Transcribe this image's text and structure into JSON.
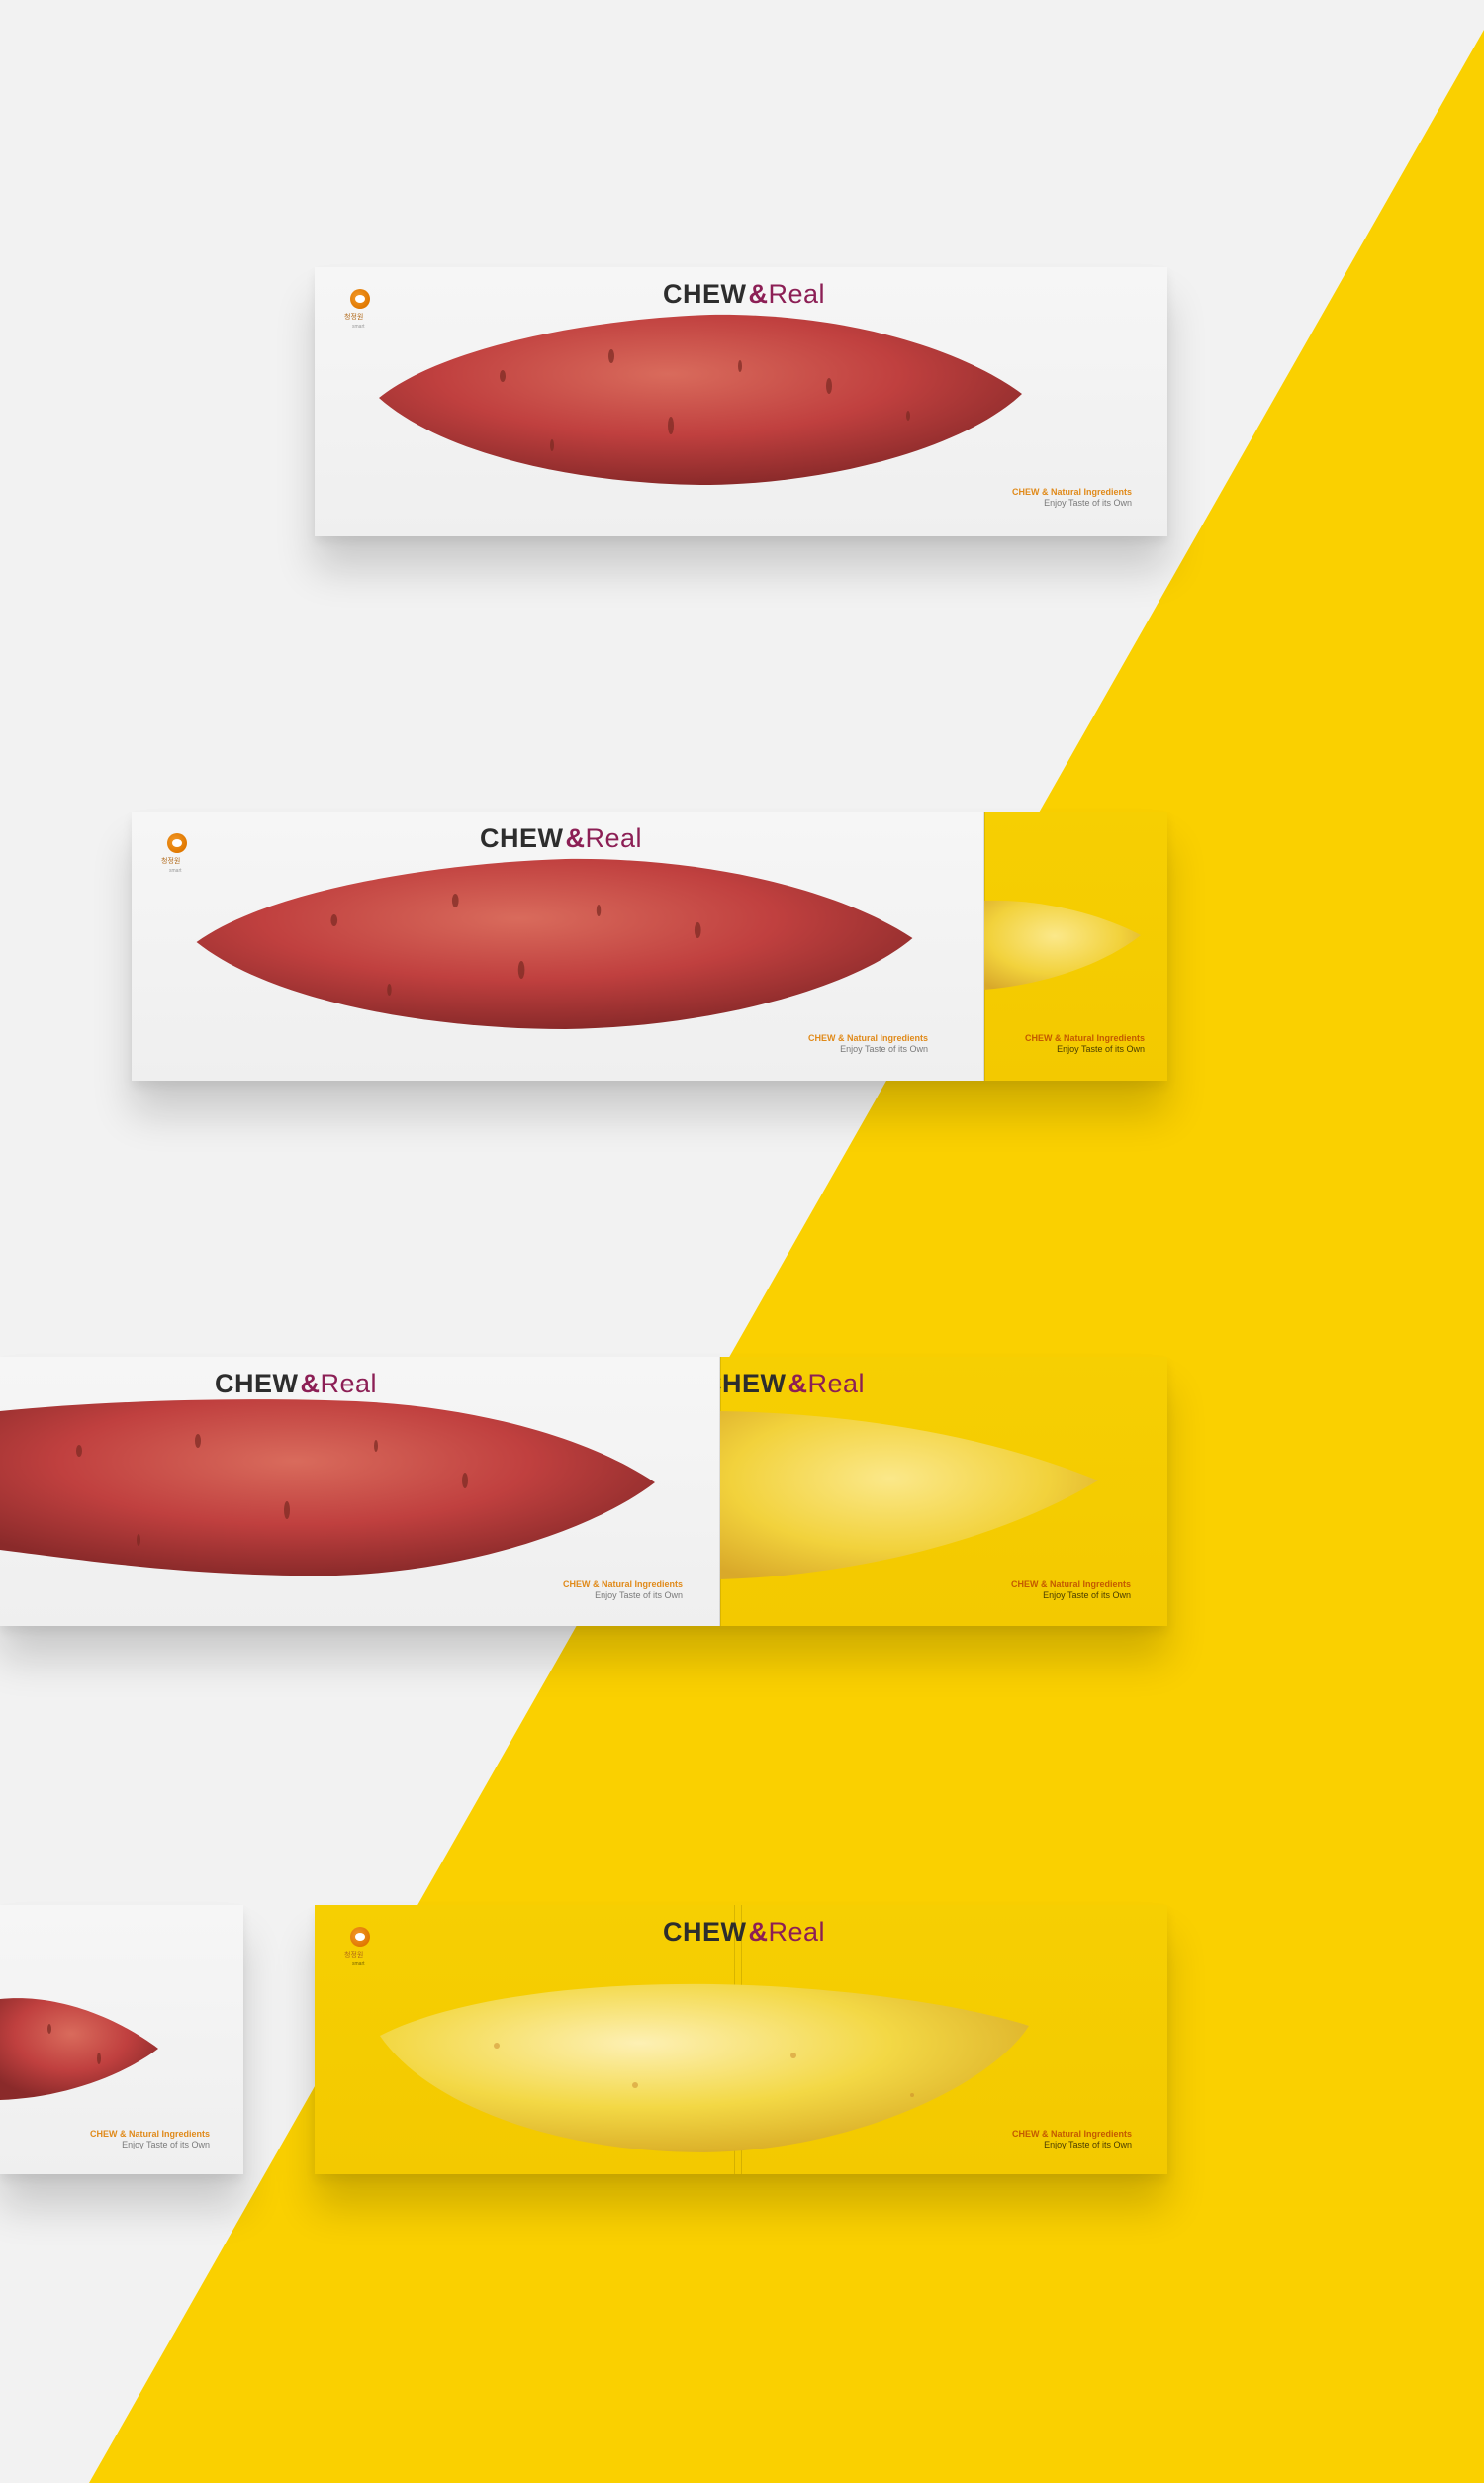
{
  "colors": {
    "background_white": "#f2f2f2",
    "background_yellow": "#fad000",
    "box_white": "#f2f2f2",
    "box_yellow": "#f5cc00",
    "brand_dark": "#2d2d2d",
    "brand_accent": "#8c1f55",
    "tagline_orange": "#e08a1a",
    "sweet_potato_skin": "#c0403f",
    "sweet_potato_flesh": "#f2d23c"
  },
  "brand": {
    "chew": "CHEW",
    "amp": "&",
    "real": "Real",
    "logo_korean": "청정원",
    "logo_sub": "smart"
  },
  "tagline": {
    "line1": "CHEW & Natural Ingredients",
    "line2": "Enjoy Taste of its Own"
  },
  "icons": [
    "chungjungone-logo-icon"
  ]
}
